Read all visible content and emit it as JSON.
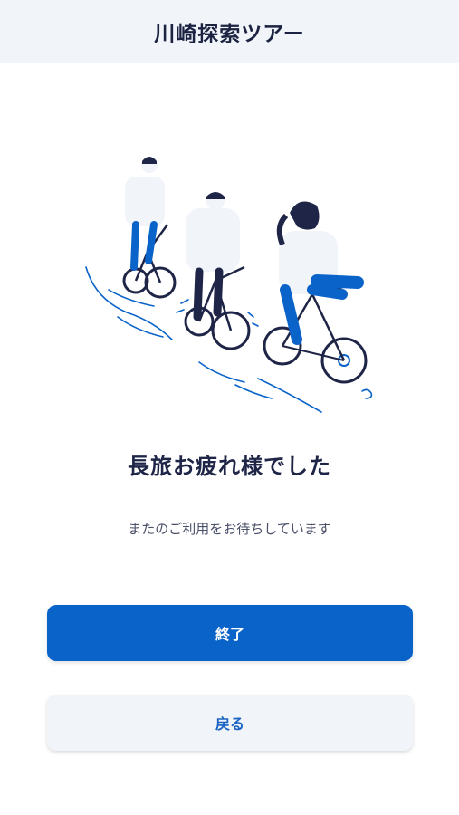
{
  "header": {
    "title": "川崎探索ツアー"
  },
  "main": {
    "heading": "長旅お疲れ様でした",
    "subtext": "またのご利用をお待ちしています"
  },
  "actions": {
    "finish_label": "終了",
    "back_label": "戻る"
  },
  "colors": {
    "primary": "#0a63c9",
    "navy": "#1f2547",
    "header_bg": "#f1f4f9"
  }
}
